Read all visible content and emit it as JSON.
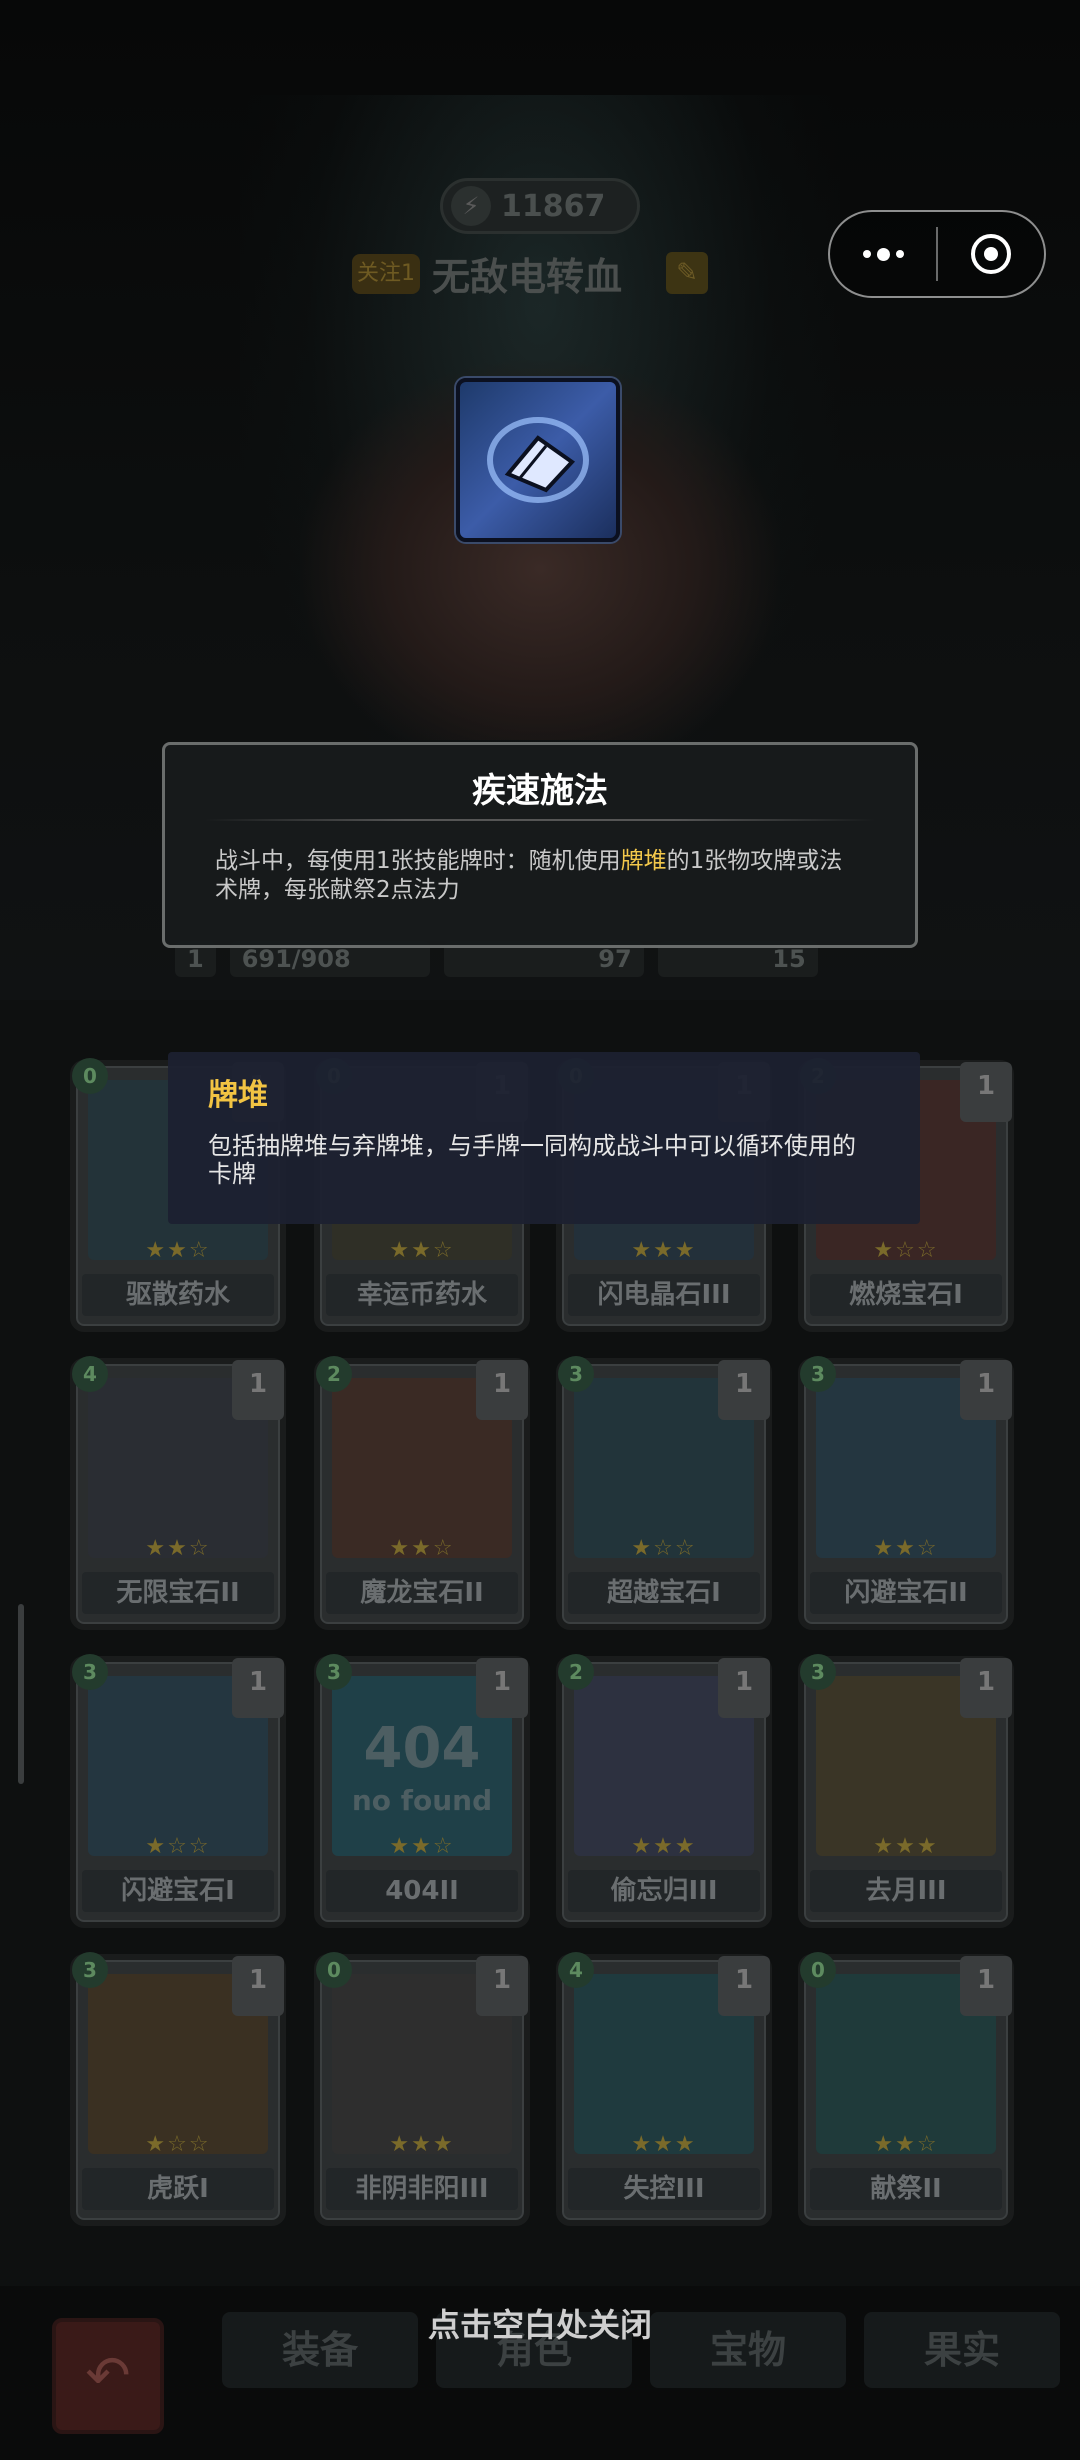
{
  "player": {
    "power": "11867",
    "follow_tag": "关注1",
    "name": "无敌电转血"
  },
  "stats": {
    "level": "1",
    "hp": "691/908",
    "attack": "97",
    "mana": "15"
  },
  "skill_tooltip": {
    "title": "疾速施法",
    "desc_before": "战斗中，每使用1张技能牌时：随机使用",
    "desc_keyword": "牌堆",
    "desc_after": "的1张物攻牌或法术牌，每张献祭2点法力"
  },
  "keyword_tooltip": {
    "title": "牌堆",
    "desc": "包括抽牌堆与弃牌堆，与手牌一同构成战斗中可以循环使用的卡牌"
  },
  "cards": [
    {
      "name": "驱散药水",
      "cost": "0",
      "level": "1",
      "stars": 2
    },
    {
      "name": "幸运币药水",
      "cost": "0",
      "level": "1",
      "stars": 2
    },
    {
      "name": "闪电晶石III",
      "cost": "0",
      "level": "1",
      "stars": 3
    },
    {
      "name": "燃烧宝石I",
      "cost": "2",
      "level": "1",
      "stars": 1
    },
    {
      "name": "无限宝石II",
      "cost": "4",
      "level": "1",
      "stars": 2
    },
    {
      "name": "魔龙宝石II",
      "cost": "2",
      "level": "1",
      "stars": 2
    },
    {
      "name": "超越宝石I",
      "cost": "3",
      "level": "1",
      "stars": 1
    },
    {
      "name": "闪避宝石II",
      "cost": "3",
      "level": "1",
      "stars": 2
    },
    {
      "name": "闪避宝石I",
      "cost": "3",
      "level": "1",
      "stars": 1
    },
    {
      "name": "404II",
      "cost": "3",
      "level": "1",
      "stars": 2
    },
    {
      "name": "偷忘归III",
      "cost": "2",
      "level": "1",
      "stars": 3
    },
    {
      "name": "去月III",
      "cost": "3",
      "level": "1",
      "stars": 3
    },
    {
      "name": "虎跃I",
      "cost": "3",
      "level": "1",
      "stars": 1
    },
    {
      "name": "非阴非阳III",
      "cost": "0",
      "level": "1",
      "stars": 3
    },
    {
      "name": "失控III",
      "cost": "4",
      "level": "1",
      "stars": 3
    },
    {
      "name": "献祭II",
      "cost": "0",
      "level": "1",
      "stars": 2
    }
  ],
  "card_404_text": "404",
  "card_404_sub": "no found",
  "tabs": {
    "equip": "装备",
    "character": "角色",
    "treasure": "宝物",
    "fruit": "果实"
  },
  "close_hint": "点击空白处关闭",
  "icons": {
    "more": "more-dots-icon",
    "close": "miniprogram-close-icon",
    "back": "back-arrow-icon",
    "edit": "pencil-icon"
  }
}
